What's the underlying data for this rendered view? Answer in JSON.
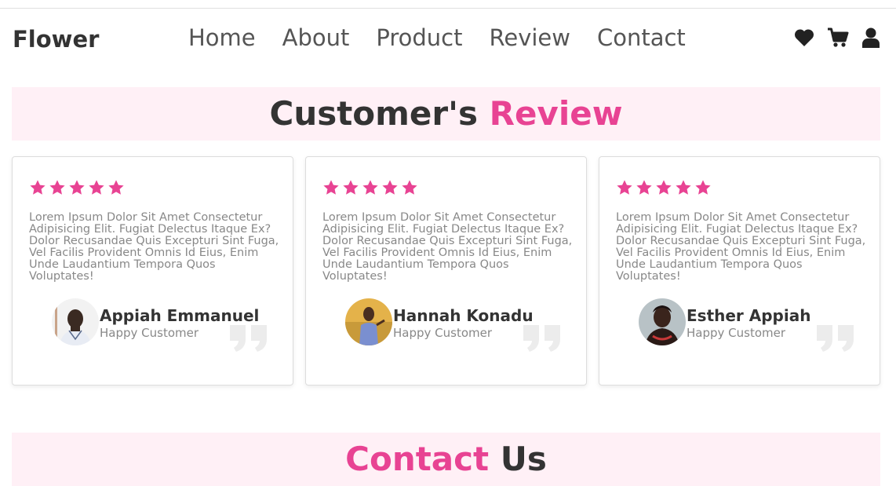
{
  "header": {
    "logo": "Flower",
    "nav": [
      "Home",
      "About",
      "Product",
      "Review",
      "Contact"
    ],
    "icons": [
      "heart-icon",
      "cart-icon",
      "user-icon"
    ]
  },
  "review_section": {
    "title_part1": "Customer's ",
    "title_part2": "Review",
    "reviews": [
      {
        "stars": 5,
        "text": "Lorem Ipsum Dolor Sit Amet Consectetur Adipisicing Elit. Fugiat Delectus Itaque Ex? Dolor Recusandae Quis Excepturi Sint Fuga, Vel Facilis Provident Omnis Id Eius, Enim Unde Laudantium Tempora Quos Voluptates!",
        "name": "Appiah Emmanuel",
        "role": "Happy Customer"
      },
      {
        "stars": 5,
        "text": "Lorem Ipsum Dolor Sit Amet Consectetur Adipisicing Elit. Fugiat Delectus Itaque Ex? Dolor Recusandae Quis Excepturi Sint Fuga, Vel Facilis Provident Omnis Id Eius, Enim Unde Laudantium Tempora Quos Voluptates!",
        "name": "Hannah Konadu",
        "role": "Happy Customer"
      },
      {
        "stars": 5,
        "text": "Lorem Ipsum Dolor Sit Amet Consectetur Adipisicing Elit. Fugiat Delectus Itaque Ex? Dolor Recusandae Quis Excepturi Sint Fuga, Vel Facilis Provident Omnis Id Eius, Enim Unde Laudantium Tempora Quos Voluptates!",
        "name": "Esther Appiah",
        "role": "Happy Customer"
      }
    ]
  },
  "contact_section": {
    "title_part1": "Contact",
    "title_part2": " Us"
  },
  "colors": {
    "accent": "#e84393",
    "heading_bg": "#fff0f6",
    "dark_text": "#333333",
    "muted_text": "#888888"
  }
}
